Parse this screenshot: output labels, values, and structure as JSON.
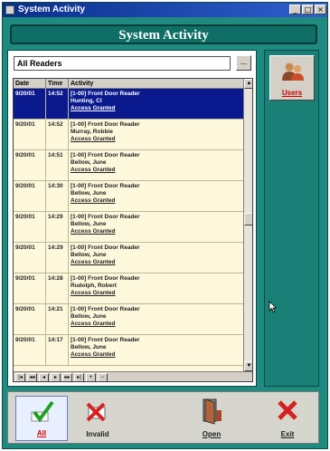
{
  "window": {
    "title": "System Activity",
    "banner": "System Activity"
  },
  "filter": {
    "selected": "All Readers",
    "browse_label": "..."
  },
  "grid": {
    "columns": [
      "Date",
      "Time",
      "Activity"
    ],
    "rows": [
      {
        "date": "9/20/01",
        "time": "14:52",
        "lines": [
          "[1-00] Front Door Reader",
          "Hunting, Cl",
          "Access Granted"
        ],
        "selected": true
      },
      {
        "date": "9/20/01",
        "time": "14:52",
        "lines": [
          "[1-00] Front Door Reader",
          "Murray, Robbie",
          "Access Granted"
        ]
      },
      {
        "date": "9/20/01",
        "time": "14:51",
        "lines": [
          "[1-00] Front Door Reader",
          "Bellow, June",
          "Access Granted"
        ]
      },
      {
        "date": "9/20/01",
        "time": "14:30",
        "lines": [
          "[1-00] Front Door Reader",
          "Bellow, June",
          "Access Granted"
        ]
      },
      {
        "date": "9/20/01",
        "time": "14:29",
        "lines": [
          "[1-00] Front Door Reader",
          "Bellow, June",
          "Access Granted"
        ]
      },
      {
        "date": "9/20/01",
        "time": "14:29",
        "lines": [
          "[1-00] Front Door Reader",
          "Bellow, June",
          "Access Granted"
        ]
      },
      {
        "date": "9/20/01",
        "time": "14:28",
        "lines": [
          "[1-00] Front Door Reader",
          "Rudolph, Robert",
          "Access Granted"
        ]
      },
      {
        "date": "9/20/01",
        "time": "14:21",
        "lines": [
          "[1-00] Front Door Reader",
          "Bellow, June",
          "Access Granted"
        ]
      },
      {
        "date": "9/20/01",
        "time": "14:17",
        "lines": [
          "[1-00] Front Door Reader",
          "Bellow, June",
          "Access Granted"
        ]
      }
    ],
    "pager": [
      "|◂",
      "◂◂",
      "◂",
      "▸",
      "▸▸",
      "▸|",
      "+",
      "−"
    ]
  },
  "sidebar": {
    "users_label": "Users"
  },
  "toolbar": {
    "all_label": "All",
    "invalid_label": "Invalid",
    "open_label": "Open",
    "exit_label": "Exit"
  },
  "colors": {
    "panel": "#1f8a80",
    "selection": "#0a1a8e",
    "grid_bg": "#fdf8dc",
    "users_label": "#d00000"
  }
}
